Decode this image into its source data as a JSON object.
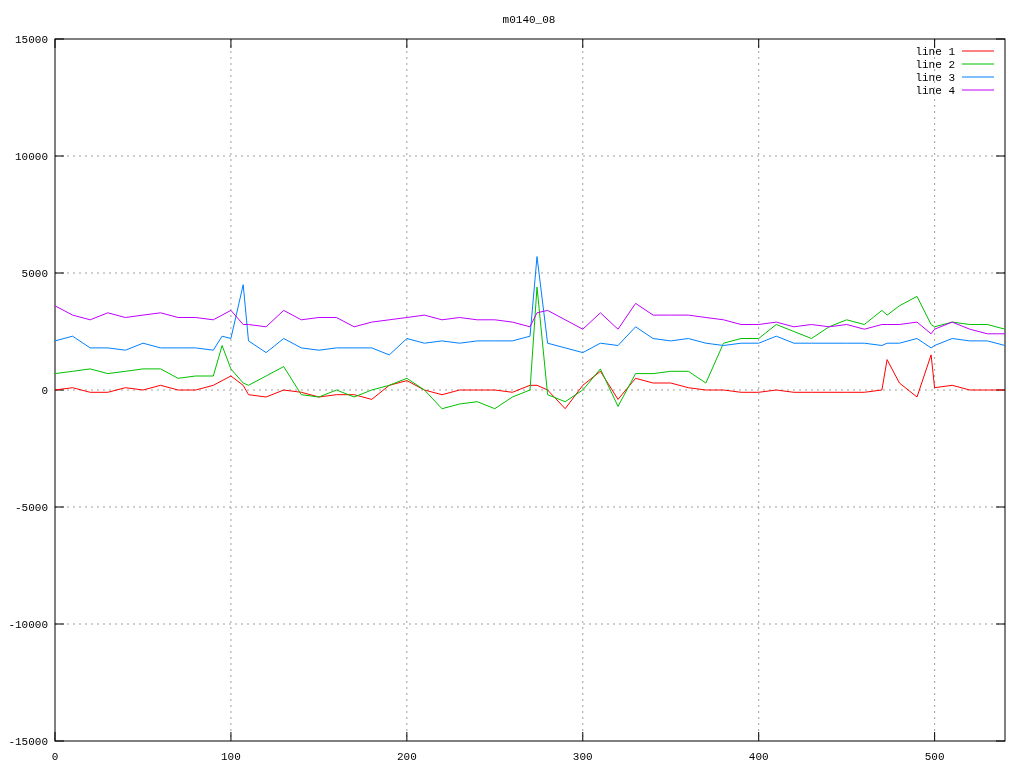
{
  "plot": {
    "chart_data": {
      "type": "line",
      "title": "m0140_08",
      "grid": true,
      "legend": true,
      "xlim": [
        0,
        540
      ],
      "ylim": [
        -15000,
        15000
      ],
      "xticks": [
        0,
        100,
        200,
        300,
        400,
        500
      ],
      "yticks": [
        -15000,
        -10000,
        -5000,
        0,
        5000,
        10000,
        15000
      ],
      "x": [
        0,
        10,
        20,
        30,
        40,
        50,
        60,
        70,
        80,
        90,
        95,
        100,
        107,
        110,
        120,
        130,
        140,
        150,
        160,
        170,
        180,
        190,
        200,
        210,
        220,
        230,
        240,
        250,
        260,
        270,
        274,
        280,
        290,
        300,
        310,
        320,
        330,
        340,
        350,
        360,
        370,
        380,
        390,
        400,
        410,
        420,
        430,
        440,
        450,
        460,
        470,
        473,
        480,
        490,
        498,
        500,
        510,
        520,
        530,
        540
      ],
      "series": [
        {
          "name": "line 1",
          "color": "#ff0000",
          "values": [
            0,
            100,
            -100,
            -100,
            100,
            0,
            200,
            0,
            0,
            200,
            400,
            600,
            200,
            -200,
            -300,
            0,
            -100,
            -300,
            -200,
            -200,
            -400,
            200,
            400,
            0,
            -200,
            0,
            0,
            0,
            -100,
            200,
            200,
            0,
            -800,
            200,
            800,
            -400,
            500,
            300,
            300,
            100,
            0,
            0,
            -100,
            -100,
            0,
            -100,
            -100,
            -100,
            -100,
            -100,
            0,
            1300,
            300,
            -300,
            1500,
            100,
            200,
            0,
            0,
            0
          ]
        },
        {
          "name": "line 2",
          "color": "#00c000",
          "values": [
            700,
            800,
            900,
            700,
            800,
            900,
            900,
            500,
            600,
            600,
            1900,
            900,
            300,
            200,
            600,
            1000,
            -200,
            -300,
            0,
            -300,
            0,
            200,
            500,
            0,
            -800,
            -600,
            -500,
            -800,
            -300,
            0,
            4400,
            -200,
            -500,
            0,
            900,
            -700,
            700,
            700,
            800,
            800,
            300,
            2000,
            2200,
            2200,
            2800,
            2500,
            2200,
            2700,
            3000,
            2800,
            3400,
            3200,
            3600,
            4000,
            2800,
            2700,
            2900,
            2800,
            2800,
            2600
          ]
        },
        {
          "name": "line 3",
          "color": "#0080ff",
          "values": [
            2100,
            2300,
            1800,
            1800,
            1700,
            2000,
            1800,
            1800,
            1800,
            1700,
            2300,
            2200,
            4500,
            2100,
            1600,
            2200,
            1800,
            1700,
            1800,
            1800,
            1800,
            1500,
            2200,
            2000,
            2100,
            2000,
            2100,
            2100,
            2100,
            2300,
            5700,
            2000,
            1800,
            1600,
            2000,
            1900,
            2700,
            2200,
            2100,
            2200,
            2000,
            1900,
            2000,
            2000,
            2300,
            2000,
            2000,
            2000,
            2000,
            2000,
            1900,
            2000,
            2000,
            2200,
            1800,
            1900,
            2200,
            2100,
            2100,
            1900
          ]
        },
        {
          "name": "line 4",
          "color": "#c000ff",
          "values": [
            3600,
            3200,
            3000,
            3300,
            3100,
            3200,
            3300,
            3100,
            3100,
            3000,
            3200,
            3400,
            2800,
            2800,
            2700,
            3400,
            3000,
            3100,
            3100,
            2700,
            2900,
            3000,
            3100,
            3200,
            3000,
            3100,
            3000,
            3000,
            2900,
            2700,
            3300,
            3400,
            3000,
            2600,
            3300,
            2600,
            3700,
            3200,
            3200,
            3200,
            3100,
            3000,
            2800,
            2800,
            2900,
            2700,
            2800,
            2700,
            2800,
            2600,
            2800,
            2800,
            2800,
            2900,
            2400,
            2600,
            2900,
            2600,
            2400,
            2400
          ]
        }
      ]
    }
  }
}
